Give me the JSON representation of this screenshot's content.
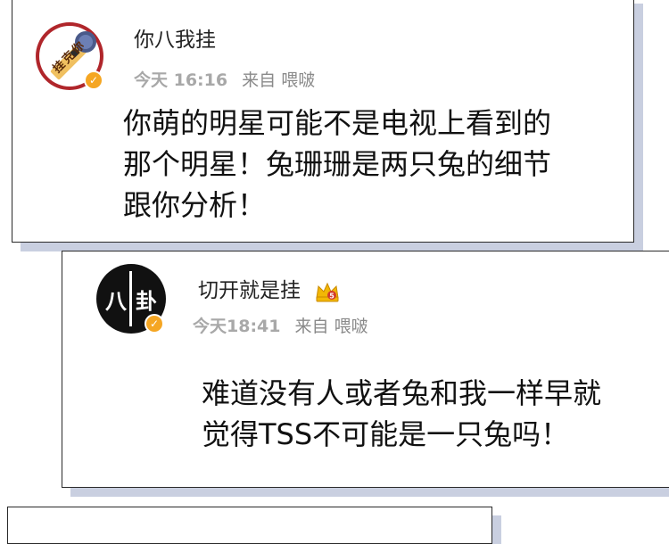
{
  "posts": [
    {
      "username": "你八我挂",
      "time": "今天 16:16",
      "source": "来自 喂啵",
      "content_lines": [
        "你萌的明星可能不是电视上看到的",
        "那个明星！兔珊珊是两只兔的细节",
        "跟你分析！"
      ],
      "avatar_text": "挂克你",
      "avatar_icon": "microphone-icon",
      "verified_icon": "verified-badge-icon"
    },
    {
      "username": "切开就是挂",
      "badge_icon": "crown-vip-icon",
      "time": "今天18:41",
      "source": "来自 喂啵",
      "content_lines": [
        "难道没有人或者兔和我一样早就",
        "觉得TSS不可能是一只兔吗！"
      ],
      "avatar_text_left": "八",
      "avatar_text_right": "卦",
      "verified_icon": "verified-badge-icon"
    }
  ],
  "colors": {
    "card_shadow": "#c9cfe0",
    "verified": "#f5a623",
    "crown": "#f2b705"
  }
}
